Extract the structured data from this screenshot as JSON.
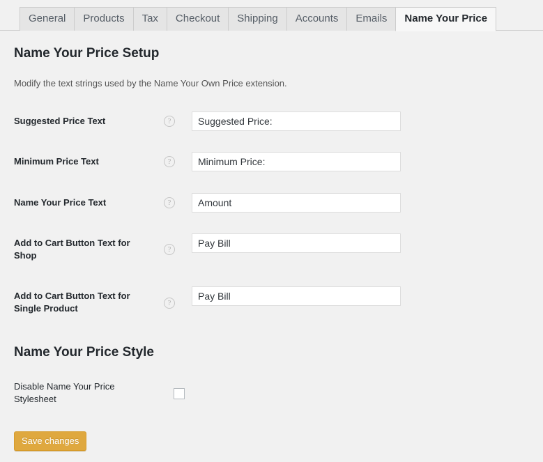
{
  "tabs": [
    {
      "label": "General",
      "active": false
    },
    {
      "label": "Products",
      "active": false
    },
    {
      "label": "Tax",
      "active": false
    },
    {
      "label": "Checkout",
      "active": false
    },
    {
      "label": "Shipping",
      "active": false
    },
    {
      "label": "Accounts",
      "active": false
    },
    {
      "label": "Emails",
      "active": false
    },
    {
      "label": "Name Your Price",
      "active": true
    }
  ],
  "setup_section": {
    "title": "Name Your Price Setup",
    "description": "Modify the text strings used by the Name Your Own Price extension.",
    "fields": [
      {
        "label": "Suggested Price Text",
        "help_icon": "question-mark-circle-icon",
        "value": "Suggested Price:",
        "placeholder": ""
      },
      {
        "label": "Minimum Price Text",
        "help_icon": "question-mark-circle-icon",
        "value": "Minimum Price:",
        "placeholder": ""
      },
      {
        "label": "Name Your Price Text",
        "help_icon": "question-mark-circle-icon",
        "value": "Amount",
        "placeholder": ""
      },
      {
        "label": "Add to Cart Button Text for Shop",
        "help_icon": "question-mark-circle-icon",
        "value": "Pay Bill",
        "placeholder": ""
      },
      {
        "label": "Add to Cart Button Text for Single Product",
        "help_icon": "question-mark-circle-icon",
        "value": "Pay Bill",
        "placeholder": ""
      }
    ]
  },
  "style_section": {
    "title": "Name Your Price Style",
    "checkbox_label": "Disable Name Your Price Stylesheet",
    "checkbox_checked": false
  },
  "submit": {
    "save_label": "Save changes"
  },
  "icons": {
    "help": "?"
  },
  "colors": {
    "page_background": "#f1f1f1",
    "tab_inactive_background": "#e5e5e5",
    "tab_active_background": "#f7f7f7",
    "tab_border": "#cccccc",
    "text_primary": "#23282d",
    "text_secondary": "#555555",
    "input_border": "#dddddd",
    "button_primary": "#dfa83f"
  }
}
